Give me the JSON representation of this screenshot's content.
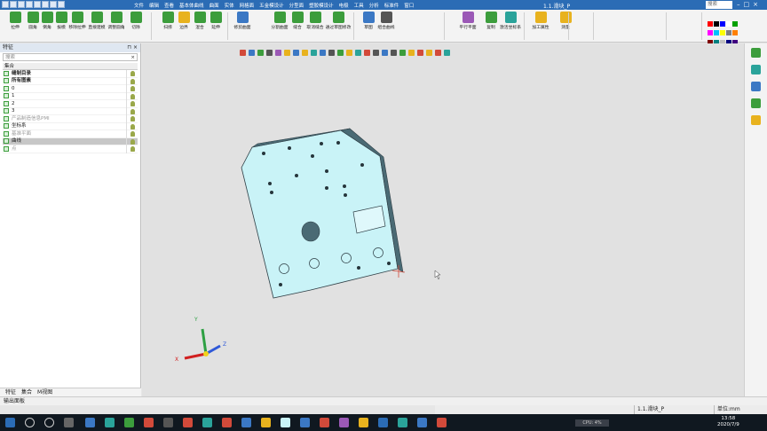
{
  "window": {
    "title": "1.1.滑块_P",
    "search_placeholder": "搜索",
    "menus": [
      "文件",
      "编辑",
      "查看",
      "基本体曲线",
      "曲面",
      "实体",
      "网格面",
      "五金模设计",
      "分型面",
      "塑胶模设计",
      "电极",
      "工具",
      "分析",
      "标准件",
      "窗口"
    ]
  },
  "ribbon": {
    "buttons": [
      {
        "label": "拉伸",
        "color": "#3c9d3c"
      },
      {
        "label": "圆角",
        "color": "#3c9d3c"
      },
      {
        "label": "倒角",
        "color": "#3c9d3c"
      },
      {
        "label": "拔模",
        "color": "#3c9d3c"
      },
      {
        "label": "移除拉伸",
        "color": "#3c9d3c"
      },
      {
        "label": "直接建模",
        "color": "#3c9d3c"
      },
      {
        "label": "调整圆角",
        "color": "#3c9d3c"
      },
      {
        "label": "切除",
        "color": "#3c9d3c"
      },
      {
        "label": "扫掠",
        "color": "#3c9d3c"
      },
      {
        "label": "边界",
        "color": "#e8b21e"
      },
      {
        "label": "混合",
        "color": "#3c9d3c"
      },
      {
        "label": "延伸",
        "color": "#3c9d3c"
      },
      {
        "label": "修剪曲面",
        "color": "#3b78c4"
      },
      {
        "label": "分割曲面",
        "color": "#3c9d3c"
      },
      {
        "label": "缝合",
        "color": "#3c9d3c"
      },
      {
        "label": "取消缝合",
        "color": "#3c9d3c"
      },
      {
        "label": "通过草图修改",
        "color": "#3c9d3c"
      },
      {
        "label": "草图",
        "color": "#3b78c4"
      },
      {
        "label": "组合曲线",
        "color": "#555555"
      },
      {
        "label": "平行平面",
        "color": "#9b59b6"
      },
      {
        "label": "复制",
        "color": "#3c9d3c"
      },
      {
        "label": "激活坐标系",
        "color": "#2aa39a"
      },
      {
        "label": "加工属性",
        "color": "#e8b21e"
      },
      {
        "label": "测量",
        "color": "#e8b21e"
      }
    ],
    "palette": [
      "#ff0000",
      "#000000",
      "#0000ff",
      "#ffffff",
      "#00a000",
      "#ff00ff",
      "#00c0ff",
      "#ffff00",
      "#808080",
      "#ff8000",
      "#800000",
      "#008080",
      "#c0c0c0",
      "#000080",
      "#400080"
    ]
  },
  "feature_panel": {
    "title": "特征",
    "search_placeholder": "搜索",
    "tree_header": "集合",
    "items": [
      {
        "label": "缝制目录",
        "style": "bold"
      },
      {
        "label": "所有图素",
        "style": "bold"
      },
      {
        "label": "0",
        "style": "normal"
      },
      {
        "label": "1",
        "style": "normal"
      },
      {
        "label": "2",
        "style": "normal"
      },
      {
        "label": "3",
        "style": "normal"
      },
      {
        "label": "产品制造信息PMI",
        "style": "grey"
      },
      {
        "label": "坐标系",
        "style": "normal"
      },
      {
        "label": "基准平面",
        "style": "grey"
      },
      {
        "label": "曲线",
        "style": "selected"
      },
      {
        "label": "点",
        "style": "grey"
      }
    ],
    "tabs": [
      "特征",
      "集合",
      "M视图"
    ]
  },
  "output_panel": {
    "title": "输出面板"
  },
  "viewport": {
    "axes": {
      "x": "X",
      "y": "Y",
      "z": "Z"
    },
    "part_color": "#c9f3f7",
    "part_side_color": "#4a6a74"
  },
  "status": {
    "doc": "1.1.滑块_P",
    "unit": "单位:mm"
  },
  "taskbar": {
    "time": "13:58",
    "date": "2020/7/9",
    "cpu": "CPU: 4%"
  }
}
